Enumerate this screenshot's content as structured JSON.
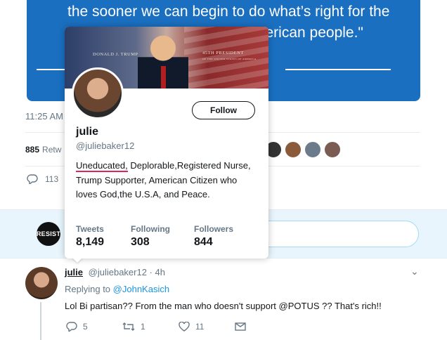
{
  "media_card": {
    "quote_line1": "the sooner we can begin to do what’s right for the",
    "quote_line2": "American people.\""
  },
  "tweet": {
    "time": "11:25 AM",
    "retweet_count": "885",
    "retweet_label": "Retw",
    "reply_count": "113"
  },
  "composer": {
    "avatar_text": "RESIST"
  },
  "hovercard": {
    "banner_left_text": "DONALD J. TRUMP",
    "banner_right_text": "45TH PRESIDENT",
    "banner_right_subtext": "OF THE UNITED STATES OF AMERICA",
    "follow_label": "Follow",
    "name": "julie",
    "handle": "@juliebaker12",
    "bio_underlined": "Uneducated,",
    "bio_rest": " Deplorable,Registered Nurse, Trump Supporter, American Citizen who loves God,the U.S.A, and Peace.",
    "stats": [
      {
        "label": "Tweets",
        "value": "8,149"
      },
      {
        "label": "Following",
        "value": "308"
      },
      {
        "label": "Followers",
        "value": "844"
      }
    ]
  },
  "reply": {
    "name": "julie",
    "handle": "@juliebaker12",
    "separator": "·",
    "time": "4h",
    "replying_prefix": "Replying to",
    "replying_handle": "@JohnKasich",
    "text": "Lol Bi partisan?? From the man who doesn't support @POTUS ?? That's rich!!",
    "actions": {
      "replies": "5",
      "retweets": "1",
      "likes": "11"
    }
  },
  "colors": {
    "media_blue": "#1a6fc0",
    "link_blue": "#1b95e0",
    "muted": "#657786",
    "text": "#14171a"
  }
}
